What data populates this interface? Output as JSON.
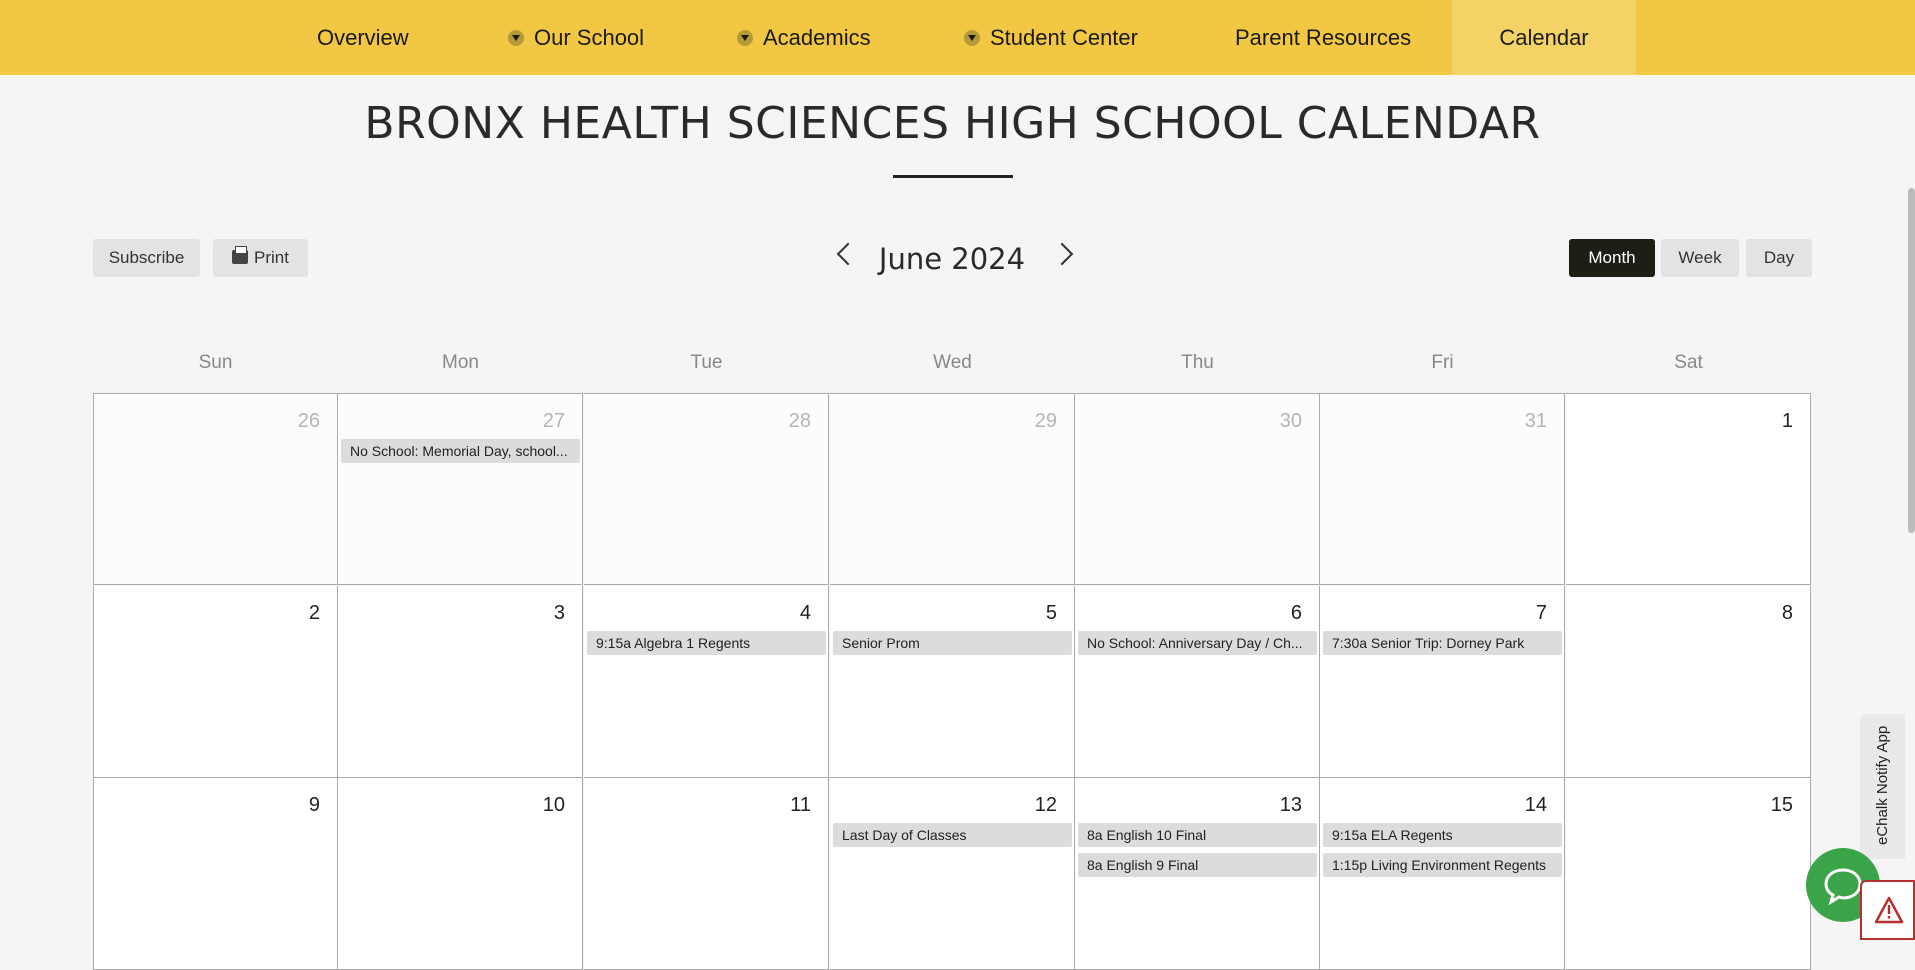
{
  "nav": {
    "items": [
      {
        "label": "Overview",
        "dropdown": false,
        "active": false
      },
      {
        "label": "Our School",
        "dropdown": true,
        "active": false
      },
      {
        "label": "Academics",
        "dropdown": true,
        "active": false
      },
      {
        "label": "Student Center",
        "dropdown": true,
        "active": false
      },
      {
        "label": "Parent Resources",
        "dropdown": false,
        "active": false
      },
      {
        "label": "Calendar",
        "dropdown": false,
        "active": true
      }
    ],
    "dropdown_icon": "chevron-down-circle-icon"
  },
  "page": {
    "title": "BRONX HEALTH SCIENCES HIGH SCHOOL CALENDAR"
  },
  "toolbar": {
    "subscribe_label": "Subscribe",
    "print_label": "Print",
    "print_icon": "printer-icon",
    "month_label": "June 2024",
    "prev_icon": "chevron-left-icon",
    "next_icon": "chevron-right-icon",
    "views": [
      {
        "label": "Month",
        "active": true
      },
      {
        "label": "Week",
        "active": false
      },
      {
        "label": "Day",
        "active": false
      }
    ]
  },
  "calendar": {
    "days_of_week": [
      "Sun",
      "Mon",
      "Tue",
      "Wed",
      "Thu",
      "Fri",
      "Sat"
    ],
    "weeks": [
      [
        {
          "day": "26",
          "other": true,
          "events": []
        },
        {
          "day": "27",
          "other": true,
          "events": [
            "No School: Memorial Day, school..."
          ]
        },
        {
          "day": "28",
          "other": true,
          "events": []
        },
        {
          "day": "29",
          "other": true,
          "events": []
        },
        {
          "day": "30",
          "other": true,
          "events": []
        },
        {
          "day": "31",
          "other": true,
          "events": []
        },
        {
          "day": "1",
          "other": false,
          "events": []
        }
      ],
      [
        {
          "day": "2",
          "other": false,
          "events": []
        },
        {
          "day": "3",
          "other": false,
          "events": []
        },
        {
          "day": "4",
          "other": false,
          "events": [
            "9:15a Algebra 1 Regents"
          ]
        },
        {
          "day": "5",
          "other": false,
          "events": [
            "Senior Prom"
          ]
        },
        {
          "day": "6",
          "other": false,
          "events": [
            "No School: Anniversary Day / Ch..."
          ]
        },
        {
          "day": "7",
          "other": false,
          "events": [
            "7:30a Senior Trip: Dorney Park"
          ]
        },
        {
          "day": "8",
          "other": false,
          "events": []
        }
      ],
      [
        {
          "day": "9",
          "other": false,
          "events": []
        },
        {
          "day": "10",
          "other": false,
          "events": []
        },
        {
          "day": "11",
          "other": false,
          "events": []
        },
        {
          "day": "12",
          "other": false,
          "events": [
            "Last Day of Classes"
          ]
        },
        {
          "day": "13",
          "other": false,
          "events": [
            "8a English 10 Final",
            "8a English 9 Final"
          ]
        },
        {
          "day": "14",
          "other": false,
          "events": [
            "9:15a ELA Regents",
            "1:15p Living Environment Regents"
          ]
        },
        {
          "day": "15",
          "other": false,
          "events": []
        }
      ]
    ]
  },
  "widgets": {
    "notify_label": "eChalk Notify App",
    "chat_icon": "chat-bubble-icon",
    "alert_icon": "warning-triangle-icon",
    "chat_color": "#3aa548",
    "alert_color": "#b53030"
  },
  "colors": {
    "nav_bg": "#f2c744",
    "nav_active_bg": "#f4d366",
    "active_view_bg": "#1e1e14"
  }
}
